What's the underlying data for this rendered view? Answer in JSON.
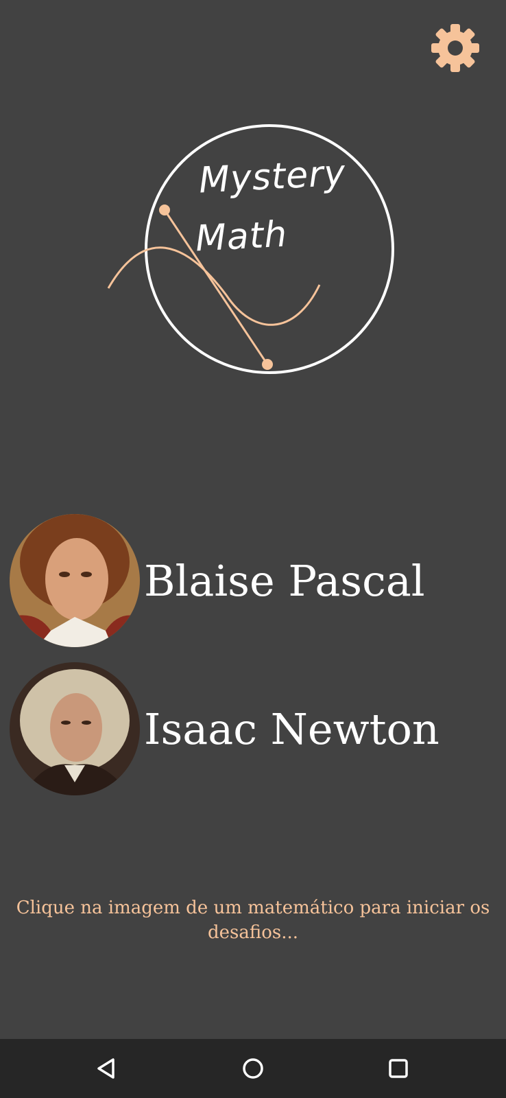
{
  "app": {
    "logo": {
      "line1": "Mystery",
      "line2": "Math"
    },
    "settings": {
      "icon": "gear-icon"
    },
    "accent_color": "#f6c39a",
    "background_color": "#424242"
  },
  "mathematicians": [
    {
      "name": "Blaise Pascal"
    },
    {
      "name": "Isaac Newton"
    }
  ],
  "hint": "Clique na imagem de um matemático para iniciar os desafios...",
  "nav_bar": {
    "back_icon": "back-triangle-icon",
    "home_icon": "home-circle-icon",
    "recent_icon": "recent-apps-square-icon"
  }
}
